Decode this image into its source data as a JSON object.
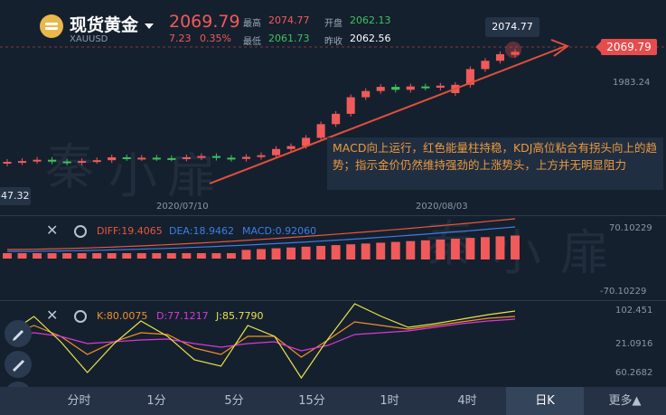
{
  "header": {
    "title": "现货黄金",
    "symbol": "XAUUSD",
    "price": "2069.79",
    "change": "7.23",
    "change_pct": "0.35%",
    "stats": [
      {
        "label": "最高",
        "value": "2074.77",
        "color": "#f05a5a"
      },
      {
        "label": "最低",
        "value": "2061.73",
        "color": "#3fc15f"
      },
      {
        "label": "开盘",
        "value": "2062.13",
        "color": "#3fc15f"
      },
      {
        "label": "昨收",
        "value": "2062.56",
        "color": "#ffffff"
      }
    ]
  },
  "price_tags": {
    "current": "2069.79",
    "high": "2074.77",
    "left_edge": "47.32"
  },
  "axis": {
    "price_level": "1983.24",
    "dates": [
      "2020/07/10",
      "2020/08/03"
    ]
  },
  "annotation": "MACD向上运行，红色能量柱持稳，KDJ高位粘合有拐头向上的趋势；指示金价仍然维持强劲的上涨势头，上方并无明显阻力",
  "watermark": [
    "秦",
    "小",
    "扉"
  ],
  "macd": {
    "diff": "DIFF:19.4065",
    "dea": "DEA:18.9462",
    "macd": "MACD:0.92060",
    "axis_top": "70.10229",
    "axis_bottom": "-70.10229"
  },
  "kdj": {
    "k": "K:80.0075",
    "d": "D:77.1217",
    "j": "J:85.7790",
    "axis_top": "102.451",
    "axis_mid": "21.0916",
    "axis_bottom": "60.2682"
  },
  "tabs": [
    {
      "label": "分时"
    },
    {
      "label": "1分"
    },
    {
      "label": "5分"
    },
    {
      "label": "15分"
    },
    {
      "label": "1时"
    },
    {
      "label": "4时"
    },
    {
      "label": "日K"
    },
    {
      "label": "更多▲"
    }
  ],
  "colors": {
    "up": "#f05a5a",
    "down": "#3fc15f",
    "diff_line": "#e8583a",
    "dea_line": "#3a7ee8",
    "k_line": "#f0902a",
    "d_line": "#d63ad6",
    "j_line": "#e8e34a"
  },
  "chart_data": {
    "type": "candlestick",
    "candles": [
      {
        "o": 1800,
        "c": 1804
      },
      {
        "o": 1803,
        "c": 1806
      },
      {
        "o": 1806,
        "c": 1809
      },
      {
        "o": 1809,
        "c": 1805
      },
      {
        "o": 1805,
        "c": 1802
      },
      {
        "o": 1802,
        "c": 1806
      },
      {
        "o": 1806,
        "c": 1808
      },
      {
        "o": 1808,
        "c": 1815
      },
      {
        "o": 1815,
        "c": 1813
      },
      {
        "o": 1813,
        "c": 1814
      },
      {
        "o": 1814,
        "c": 1813
      },
      {
        "o": 1813,
        "c": 1812
      },
      {
        "o": 1812,
        "c": 1815
      },
      {
        "o": 1815,
        "c": 1818
      },
      {
        "o": 1818,
        "c": 1814
      },
      {
        "o": 1814,
        "c": 1811
      },
      {
        "o": 1811,
        "c": 1816
      },
      {
        "o": 1816,
        "c": 1820
      },
      {
        "o": 1820,
        "c": 1835
      },
      {
        "o": 1835,
        "c": 1842
      },
      {
        "o": 1842,
        "c": 1862
      },
      {
        "o": 1862,
        "c": 1895
      },
      {
        "o": 1895,
        "c": 1920
      },
      {
        "o": 1920,
        "c": 1960
      },
      {
        "o": 1960,
        "c": 1975
      },
      {
        "o": 1975,
        "c": 1985
      },
      {
        "o": 1985,
        "c": 1978
      },
      {
        "o": 1978,
        "c": 1986
      },
      {
        "o": 1986,
        "c": 1983
      },
      {
        "o": 1983,
        "c": 1988
      },
      {
        "o": 1970,
        "c": 1990
      },
      {
        "o": 1990,
        "c": 2028
      },
      {
        "o": 2028,
        "c": 2048
      },
      {
        "o": 2048,
        "c": 2064
      },
      {
        "o": 2062.13,
        "c": 2069.79
      }
    ],
    "y_range": [
      1780,
      2090
    ]
  }
}
